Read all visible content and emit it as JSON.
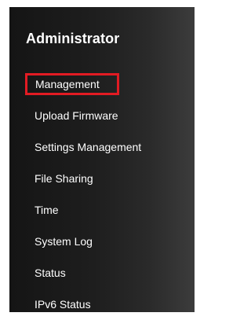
{
  "sidebar": {
    "title": "Administrator",
    "items": [
      {
        "label": "Management",
        "selected": true
      },
      {
        "label": "Upload Firmware"
      },
      {
        "label": "Settings Management"
      },
      {
        "label": "File Sharing"
      },
      {
        "label": "Time"
      },
      {
        "label": "System Log"
      },
      {
        "label": "Status"
      },
      {
        "label": "IPv6 Status"
      }
    ]
  },
  "colors": {
    "panel_background": "#1e1e1e",
    "text": "#ffffff",
    "selection_outline": "#e21b23"
  }
}
